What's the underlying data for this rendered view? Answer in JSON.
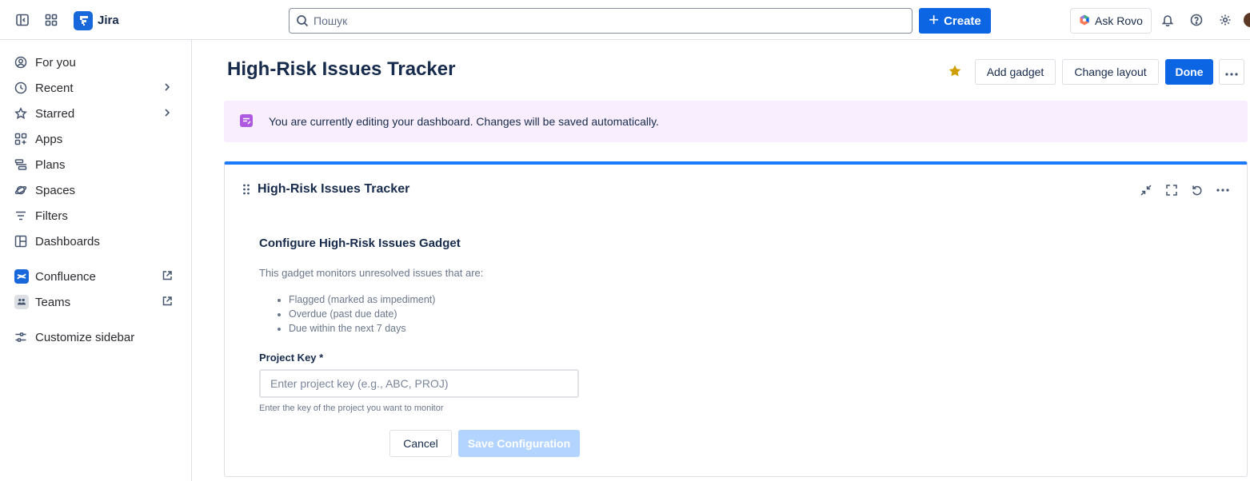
{
  "app": {
    "name": "Jira"
  },
  "search": {
    "placeholder": "Пошук"
  },
  "topbar": {
    "create_label": "Create",
    "ask_rovo_label": "Ask Rovo"
  },
  "sidebar": {
    "items": [
      {
        "label": "For you",
        "icon": "person-circle-icon"
      },
      {
        "label": "Recent",
        "icon": "clock-icon"
      },
      {
        "label": "Starred",
        "icon": "star-icon"
      },
      {
        "label": "Apps",
        "icon": "apps-icon"
      },
      {
        "label": "Plans",
        "icon": "plans-icon"
      },
      {
        "label": "Spaces",
        "icon": "planet-icon"
      },
      {
        "label": "Filters",
        "icon": "filter-icon"
      },
      {
        "label": "Dashboards",
        "icon": "dashboard-icon"
      },
      {
        "label": "Confluence",
        "icon": "confluence-logo"
      },
      {
        "label": "Teams",
        "icon": "teams-logo"
      },
      {
        "label": "Customize sidebar",
        "icon": "customize-icon"
      }
    ]
  },
  "page": {
    "title": "High-Risk Issues Tracker",
    "add_gadget_label": "Add gadget",
    "change_layout_label": "Change layout",
    "done_label": "Done"
  },
  "banner": {
    "text": "You are currently editing your dashboard. Changes will be saved automatically."
  },
  "gadget": {
    "title": "High-Risk Issues Tracker",
    "config_title": "Configure High-Risk Issues Gadget",
    "description": "This gadget monitors unresolved issues that are:",
    "criteria": [
      "Flagged (marked as impediment)",
      "Overdue (past due date)",
      "Due within the next 7 days"
    ],
    "field_label": "Project Key *",
    "field_placeholder": "Enter project key (e.g., ABC, PROJ)",
    "field_value": "",
    "field_help": "Enter the key of the project you want to monitor",
    "cancel_label": "Cancel",
    "save_label": "Save Configuration"
  },
  "colors": {
    "brand": "#0c66e4",
    "banner_bg": "#f8eefe",
    "gadget_accent": "#1d7afc",
    "star": "#cf9f02",
    "save_disabled": "#b3d4ff"
  }
}
